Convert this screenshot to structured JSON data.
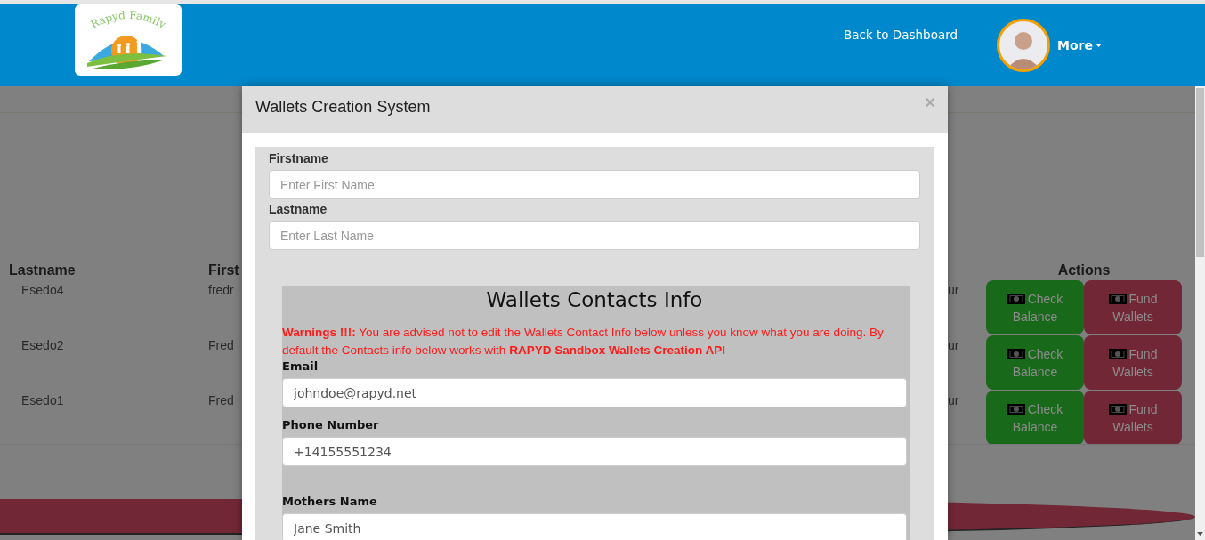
{
  "header": {
    "logo_text": "Rapyd Family",
    "nav_link": "Back to Dashboard",
    "menu_label": "More"
  },
  "table": {
    "columns": [
      {
        "label": "Lastname"
      },
      {
        "label": "First"
      },
      {
        "label": "Actions"
      }
    ],
    "rows": [
      {
        "lastname": "Esedo4",
        "firstname": "fredr",
        "column_3": "ur",
        "actions": [
          {
            "kind": "check",
            "label": "Check Balance"
          },
          {
            "kind": "fund",
            "label": "Fund Wallets"
          }
        ]
      },
      {
        "lastname": "Esedo2",
        "firstname": "Fred",
        "column_3": "ur",
        "actions": [
          {
            "kind": "check",
            "label": "Check Balance"
          },
          {
            "kind": "fund",
            "label": "Fund Wallets"
          }
        ]
      },
      {
        "lastname": "Esedo1",
        "firstname": "Fred",
        "column_3": "ur",
        "actions": [
          {
            "kind": "check",
            "label": "Check Balance"
          },
          {
            "kind": "fund",
            "label": "Fund Wallets"
          }
        ]
      }
    ]
  },
  "modal": {
    "title": "Wallets Creation System",
    "close": "×",
    "fields": [
      {
        "label": "Firstname",
        "placeholder": "Enter First Name"
      },
      {
        "label": "Lastname",
        "placeholder": "Enter Last Name"
      }
    ],
    "contacts": {
      "heading": "Wallets Contacts Info",
      "warning": "**Warnings !!!:** You are advised not to edit the Wallets Contact Info below unless you know what you are doing. By default the Contacts info below works with **RAPYD Sandbox Wallets Creation API**",
      "fields": [
        {
          "label": "Email",
          "value": "johndoe@rapyd.net"
        },
        {
          "label": "Phone Number",
          "value": "+14155551234"
        },
        {
          "label": "Mothers Name",
          "value": "Jane Smith"
        }
      ]
    }
  }
}
